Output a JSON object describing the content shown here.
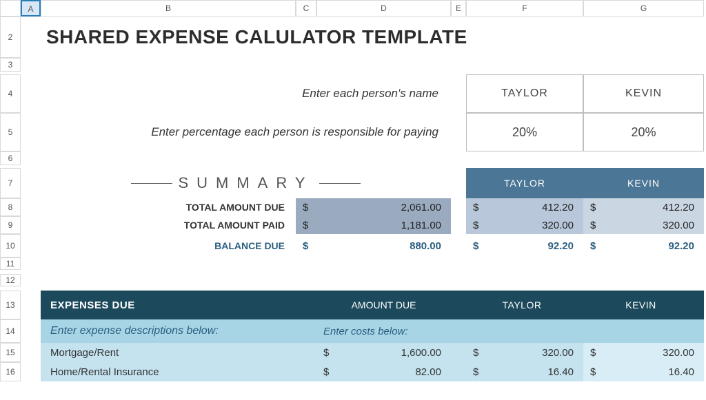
{
  "columns": [
    "A",
    "B",
    "C",
    "D",
    "E",
    "F",
    "G"
  ],
  "rows": [
    "2",
    "3",
    "4",
    "5",
    "6",
    "7",
    "8",
    "9",
    "10",
    "11",
    "12",
    "13",
    "14",
    "15",
    "16"
  ],
  "title": "SHARED EXPENSE CALULATOR TEMPLATE",
  "instructions": {
    "names": "Enter each person's name",
    "percentages": "Enter percentage each person is responsible for paying"
  },
  "people": [
    {
      "name": "TAYLOR",
      "percent": "20%"
    },
    {
      "name": "KEVIN",
      "percent": "20%"
    }
  ],
  "summary": {
    "heading_word": "SUMMARY",
    "labels": {
      "total_due": "TOTAL AMOUNT DUE",
      "total_paid": "TOTAL AMOUNT PAID",
      "balance_due": "BALANCE DUE"
    },
    "totals": {
      "due": "2,061.00",
      "paid": "1,181.00",
      "balance": "880.00"
    },
    "per_person": [
      {
        "due": "412.20",
        "paid": "320.00",
        "balance": "92.20"
      },
      {
        "due": "412.20",
        "paid": "320.00",
        "balance": "92.20"
      }
    ]
  },
  "expenses": {
    "header": "EXPENSES DUE",
    "col_amount": "AMOUNT DUE",
    "instr_desc": "Enter expense descriptions below:",
    "instr_cost": "Enter costs below:",
    "rows": [
      {
        "desc": "Mortgage/Rent",
        "amount": "1,600.00",
        "p0": "320.00",
        "p1": "320.00"
      },
      {
        "desc": "Home/Rental Insurance",
        "amount": "82.00",
        "p0": "16.40",
        "p1": "16.40"
      }
    ]
  },
  "currency": "$"
}
